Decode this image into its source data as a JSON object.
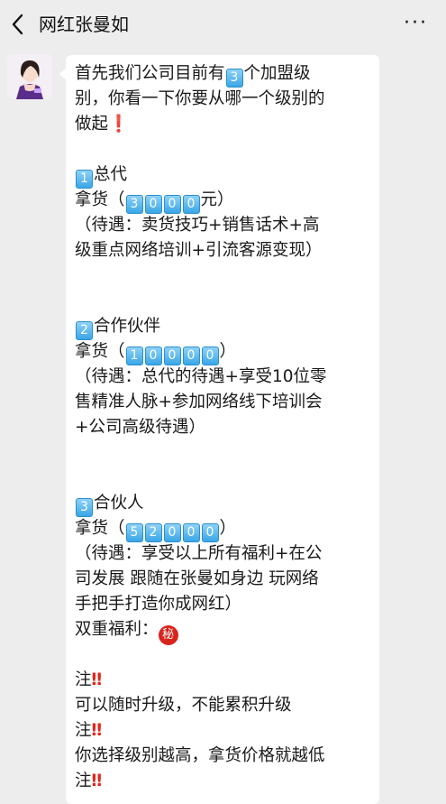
{
  "header": {
    "title": "网红张曼如",
    "more": "···"
  },
  "message": {
    "intro1": "首先我们公司目前有",
    "intro_num": "3",
    "intro2": "个加盟级",
    "intro3": "别，你看一下你要从哪一个级别的",
    "intro4": "做起",
    "exclaim": "❗",
    "tier1": {
      "num": "1",
      "name": "总代",
      "price_prefix": "拿货（",
      "price_digits": [
        "3",
        "0",
        "0",
        "0"
      ],
      "price_suffix": "元）",
      "benefit_l1": "（待遇：卖货技巧+销售话术+高",
      "benefit_l2": "级重点网络培训+引流客源变现）"
    },
    "tier2": {
      "num": "2",
      "name": "合作伙伴",
      "price_prefix": "拿货（",
      "price_digits": [
        "1",
        "0",
        "0",
        "0",
        "0"
      ],
      "price_suffix": "）",
      "benefit_l1": "（待遇：总代的待遇+享受10位零",
      "benefit_l2": "售精准人脉+参加网络线下培训会",
      "benefit_l3": "+公司高级待遇）"
    },
    "tier3": {
      "num": "3",
      "name": "合伙人",
      "price_prefix": "拿货（",
      "price_digits": [
        "5",
        "2",
        "0",
        "0",
        "0"
      ],
      "price_suffix": "）",
      "benefit_l1": "（待遇：享受以上所有福利+在公",
      "benefit_l2": "司发展 跟随在张曼如身边 玩网络",
      "benefit_l3": "手把手打造你成网红）"
    },
    "double_benefit": "双重福利：",
    "secret_badge": "秘",
    "note_label": "注",
    "note_marks": "‼",
    "note1": "可以随时升级，不能累积升级",
    "note2": "你选择级别越高，拿货价格就越低"
  },
  "colors": {
    "background": "#ededed",
    "bubble": "#ffffff",
    "keycap": "#3aa6e6",
    "emphasis": "#e0251b"
  },
  "icons": {
    "back": "chevron-left-icon",
    "more": "more-dots-icon",
    "secret": "secret-badge-icon"
  }
}
